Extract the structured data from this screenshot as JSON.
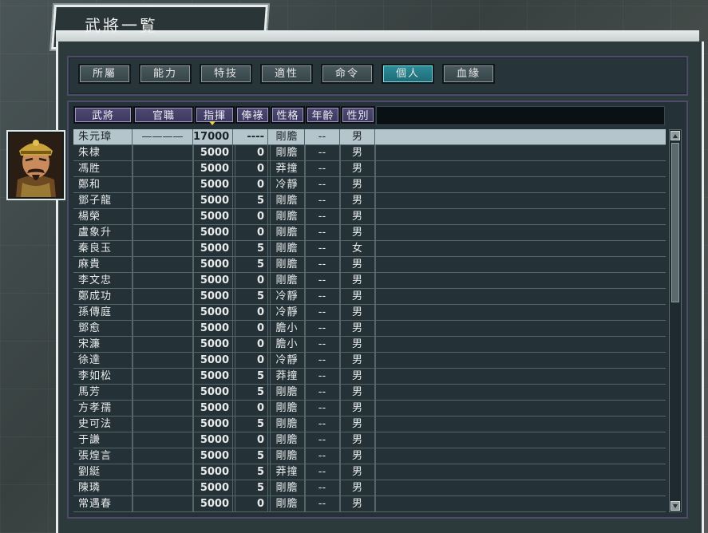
{
  "window": {
    "title": "武將一覧"
  },
  "tabs": [
    {
      "label": "所屬",
      "active": false
    },
    {
      "label": "能力",
      "active": false
    },
    {
      "label": "特技",
      "active": false
    },
    {
      "label": "適性",
      "active": false
    },
    {
      "label": "命令",
      "active": false
    },
    {
      "label": "個人",
      "active": true
    },
    {
      "label": "血緣",
      "active": false
    }
  ],
  "columns": [
    "武將",
    "官職",
    "指揮",
    "俸祿",
    "性格",
    "年齡",
    "性別"
  ],
  "sort_column": "指揮",
  "rows": [
    {
      "name": "朱元璋",
      "rank": "————",
      "command": "17000",
      "salary": "----",
      "personality": "剛膽",
      "age": "--",
      "sex": "男",
      "selected": true
    },
    {
      "name": "朱棣",
      "rank": "",
      "command": "5000",
      "salary": "0",
      "personality": "剛膽",
      "age": "--",
      "sex": "男"
    },
    {
      "name": "馮胜",
      "rank": "",
      "command": "5000",
      "salary": "0",
      "personality": "莽撞",
      "age": "--",
      "sex": "男"
    },
    {
      "name": "鄭和",
      "rank": "",
      "command": "5000",
      "salary": "0",
      "personality": "冷靜",
      "age": "--",
      "sex": "男"
    },
    {
      "name": "鄧子龍",
      "rank": "",
      "command": "5000",
      "salary": "5",
      "personality": "剛膽",
      "age": "--",
      "sex": "男"
    },
    {
      "name": "楊榮",
      "rank": "",
      "command": "5000",
      "salary": "0",
      "personality": "剛膽",
      "age": "--",
      "sex": "男"
    },
    {
      "name": "盧象升",
      "rank": "",
      "command": "5000",
      "salary": "0",
      "personality": "剛膽",
      "age": "--",
      "sex": "男"
    },
    {
      "name": "秦良玉",
      "rank": "",
      "command": "5000",
      "salary": "5",
      "personality": "剛膽",
      "age": "--",
      "sex": "女"
    },
    {
      "name": "麻貴",
      "rank": "",
      "command": "5000",
      "salary": "5",
      "personality": "剛膽",
      "age": "--",
      "sex": "男"
    },
    {
      "name": "李文忠",
      "rank": "",
      "command": "5000",
      "salary": "0",
      "personality": "剛膽",
      "age": "--",
      "sex": "男"
    },
    {
      "name": "鄭成功",
      "rank": "",
      "command": "5000",
      "salary": "5",
      "personality": "冷靜",
      "age": "--",
      "sex": "男"
    },
    {
      "name": "孫傳庭",
      "rank": "",
      "command": "5000",
      "salary": "0",
      "personality": "冷靜",
      "age": "--",
      "sex": "男"
    },
    {
      "name": "鄧愈",
      "rank": "",
      "command": "5000",
      "salary": "0",
      "personality": "膽小",
      "age": "--",
      "sex": "男"
    },
    {
      "name": "宋濂",
      "rank": "",
      "command": "5000",
      "salary": "0",
      "personality": "膽小",
      "age": "--",
      "sex": "男"
    },
    {
      "name": "徐達",
      "rank": "",
      "command": "5000",
      "salary": "0",
      "personality": "冷靜",
      "age": "--",
      "sex": "男"
    },
    {
      "name": "李如松",
      "rank": "",
      "command": "5000",
      "salary": "5",
      "personality": "莽撞",
      "age": "--",
      "sex": "男"
    },
    {
      "name": "馬芳",
      "rank": "",
      "command": "5000",
      "salary": "5",
      "personality": "剛膽",
      "age": "--",
      "sex": "男"
    },
    {
      "name": "方孝孺",
      "rank": "",
      "command": "5000",
      "salary": "0",
      "personality": "剛膽",
      "age": "--",
      "sex": "男"
    },
    {
      "name": "史可法",
      "rank": "",
      "command": "5000",
      "salary": "5",
      "personality": "剛膽",
      "age": "--",
      "sex": "男"
    },
    {
      "name": "于謙",
      "rank": "",
      "command": "5000",
      "salary": "0",
      "personality": "剛膽",
      "age": "--",
      "sex": "男"
    },
    {
      "name": "張煌言",
      "rank": "",
      "command": "5000",
      "salary": "5",
      "personality": "剛膽",
      "age": "--",
      "sex": "男"
    },
    {
      "name": "劉綎",
      "rank": "",
      "command": "5000",
      "salary": "5",
      "personality": "莽撞",
      "age": "--",
      "sex": "男"
    },
    {
      "name": "陳璘",
      "rank": "",
      "command": "5000",
      "salary": "5",
      "personality": "剛膽",
      "age": "--",
      "sex": "男"
    },
    {
      "name": "常遇春",
      "rank": "",
      "command": "5000",
      "salary": "0",
      "personality": "剛膽",
      "age": "--",
      "sex": "男"
    }
  ],
  "colors": {
    "active_tab": "#2d8e9a",
    "header": "#4e4a72",
    "selected_row": "#b5c5cc"
  }
}
